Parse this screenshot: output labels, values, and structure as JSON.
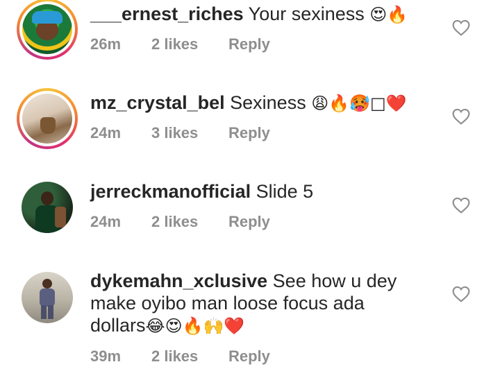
{
  "comments": [
    {
      "username": "___ernest_riches",
      "text": "Your sexiness",
      "emojis": "😍🔥",
      "time": "26m",
      "likes": "2 likes",
      "reply": "Reply",
      "avatar_colors": [
        "#1b7a3a",
        "#2bb14f",
        "#f0c419"
      ]
    },
    {
      "username": "mz_crystal_bel",
      "text": "Sexiness",
      "emojis": "😩🔥🥵□❤️",
      "time": "24m",
      "likes": "3 likes",
      "reply": "Reply",
      "avatar_colors": [
        "#e8ded2",
        "#8a6a4a",
        "#d9c8b6"
      ]
    },
    {
      "username": "jerreckmanofficial",
      "text": "Slide 5",
      "time": "24m",
      "likes": "2 likes",
      "reply": "Reply",
      "avatar_colors": [
        "#1a2a1c",
        "#2f5f3a",
        "#7b5233"
      ]
    },
    {
      "username": "dykemahn_xclusive",
      "text_line1": "See how u dey",
      "text_line2": "make oyibo man loose focus ada",
      "text_line3": "dollars",
      "emojis": "😂😍🔥🙌❤️",
      "time": "39m",
      "likes": "2 likes",
      "reply": "Reply",
      "avatar_colors": [
        "#c9c4b8",
        "#4b4f6a",
        "#8f8a7e"
      ]
    }
  ],
  "icons": {
    "like": "heart-outline-icon"
  },
  "colors": {
    "meta": "#8e8e8e",
    "text": "#262626",
    "heart": "#8e8e8e"
  }
}
